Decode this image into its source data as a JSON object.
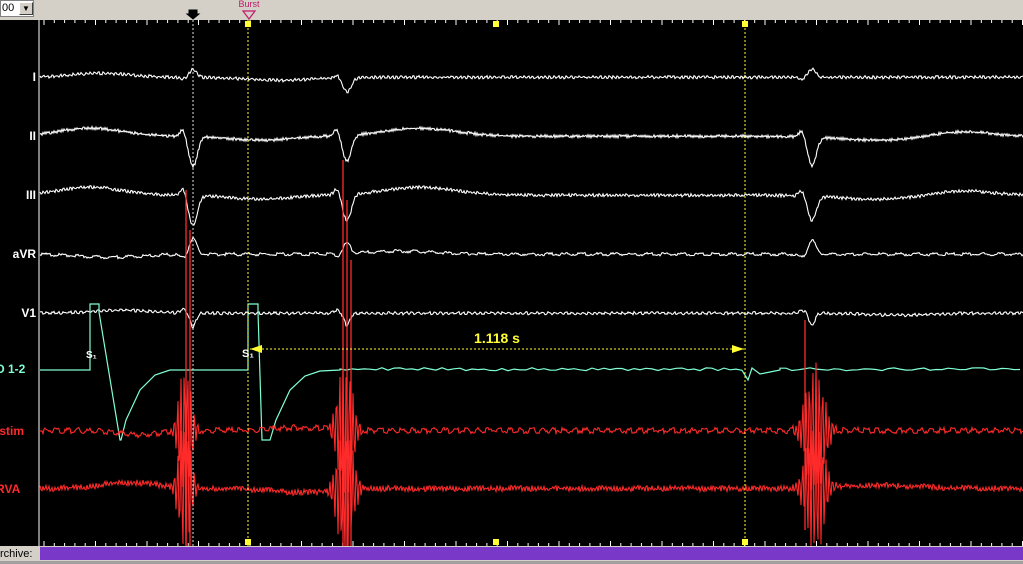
{
  "toolbar": {
    "sweep_value": "00",
    "marker_label": "Burst"
  },
  "status": {
    "archive_label": "rchive:"
  },
  "leads": [
    {
      "name": "I",
      "color": "#ffffff"
    },
    {
      "name": "II",
      "color": "#ffffff"
    },
    {
      "name": "III",
      "color": "#ffffff"
    },
    {
      "name": "aVR",
      "color": "#ffffff"
    },
    {
      "name": "V1",
      "color": "#ffffff"
    },
    {
      "name": "D 1-2",
      "color": "#7fffd4"
    },
    {
      "name": "/stim",
      "color": "#ff2a2a"
    },
    {
      "name": "RVA",
      "color": "#ff2a2a"
    }
  ],
  "annotations": {
    "measurement": "1.118 s",
    "stim_label_1": "S₁",
    "stim_label_2": "S₁"
  },
  "colors": {
    "caliper": "#ffff33",
    "marker": "#ff3366",
    "surface_ecg": "#ffffff",
    "intracardiac": "#ff2a2a",
    "stim": "#7fffd4"
  }
}
